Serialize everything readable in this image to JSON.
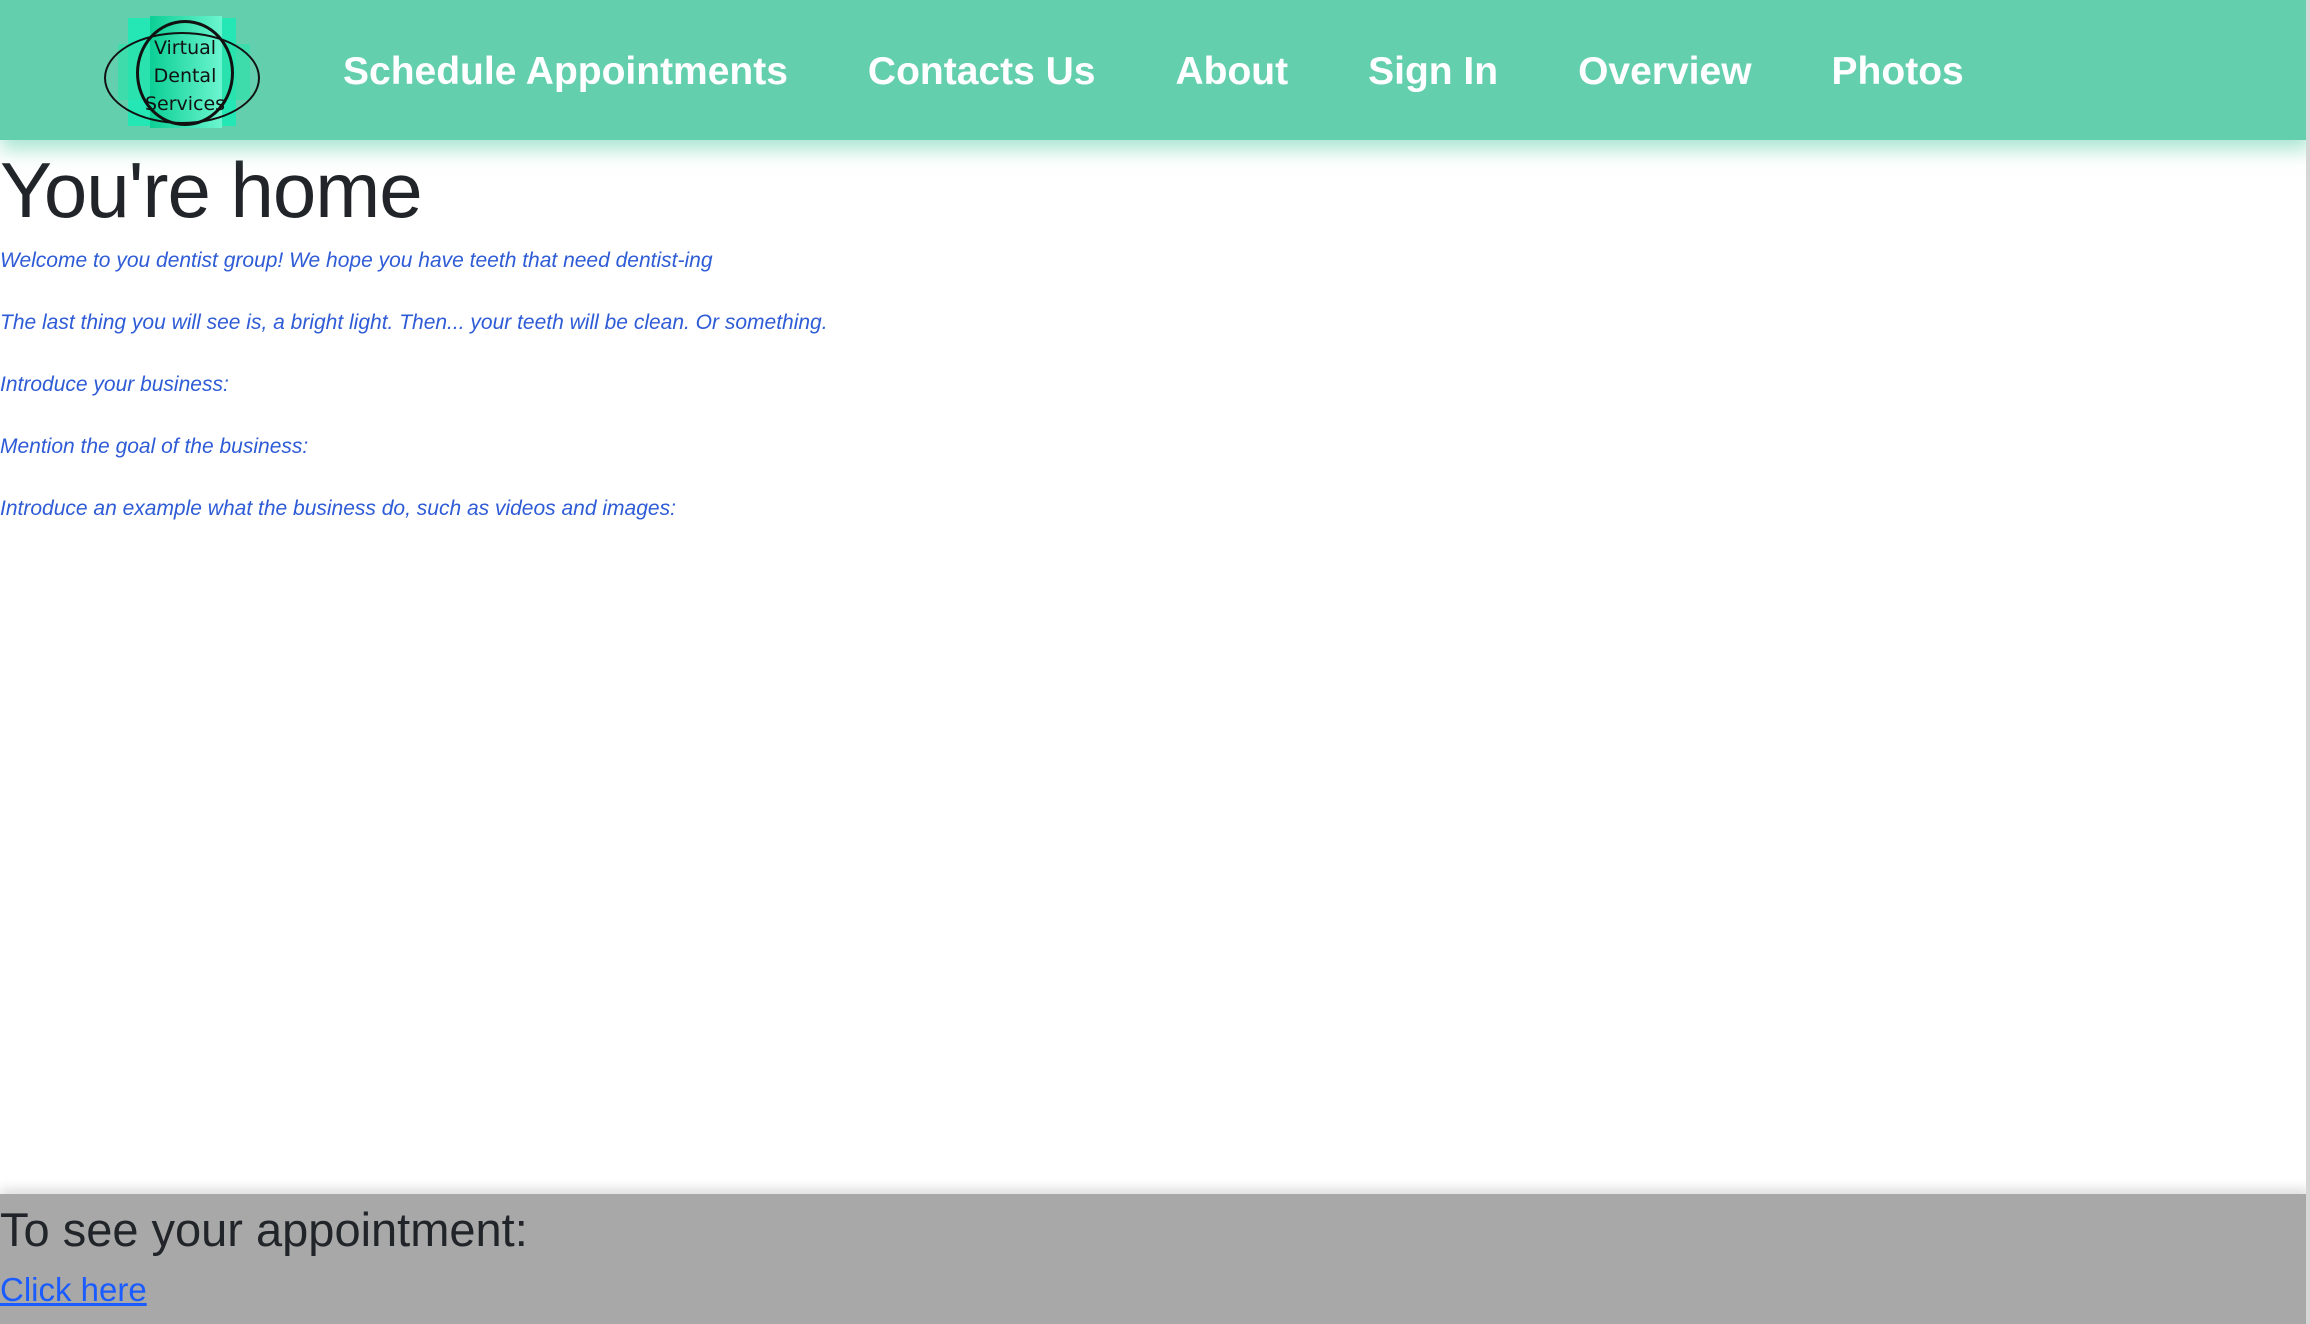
{
  "logo": {
    "text_lines": [
      "Virtual",
      "Dental",
      "Services"
    ],
    "colors": {
      "primary": "#1de9b6",
      "ring": "#111111"
    }
  },
  "navbar": {
    "background": "#64cfad",
    "links": [
      {
        "label": "Schedule Appointments"
      },
      {
        "label": "Contacts Us"
      },
      {
        "label": "About"
      },
      {
        "label": "Sign In"
      },
      {
        "label": "Overview"
      },
      {
        "label": "Photos"
      }
    ]
  },
  "main": {
    "title": "You're home",
    "paragraphs": [
      "Welcome to you dentist group! We hope you have teeth that need dentist-ing",
      "The last thing you will see is, a bright light. Then... your teeth will be clean. Or something.",
      "Introduce your business:",
      "Mention the goal of the business:",
      "Introduce an example what the business do, such as videos and images:"
    ],
    "text_color": "#2e5bd6"
  },
  "footer": {
    "heading": "To see your appointment:",
    "link_label": "Click here",
    "background": "#a8a8a8"
  }
}
